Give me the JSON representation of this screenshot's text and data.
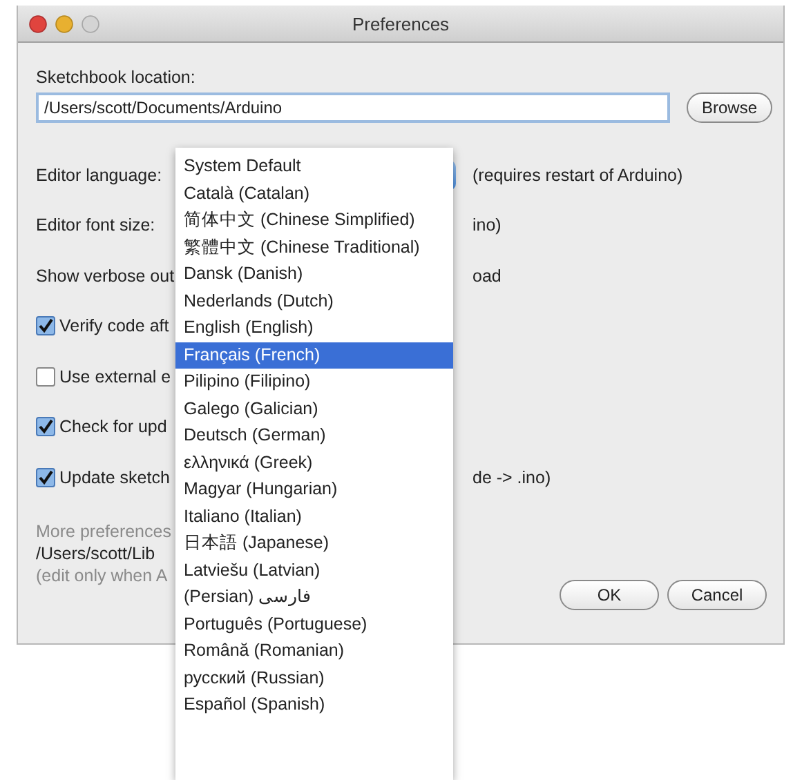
{
  "window": {
    "title": "Preferences"
  },
  "sketchbook": {
    "label": "Sketchbook location:",
    "value": "/Users/scott/Documents/Arduino",
    "button": "Browse"
  },
  "settings": [
    {
      "kind": "popup",
      "label": "Editor language:",
      "note": "(requires restart of Arduino)"
    },
    {
      "kind": "text",
      "label": "Editor font size:",
      "note": "ino)"
    },
    {
      "kind": "text",
      "label": "Show verbose out",
      "note": "oad"
    },
    {
      "kind": "checkbox",
      "label": "Verify code aft",
      "checked": true
    },
    {
      "kind": "checkbox",
      "label": "Use external e",
      "checked": false
    },
    {
      "kind": "checkbox",
      "label": "Check for upd",
      "checked": true
    },
    {
      "kind": "checkbox",
      "label": "Update sketch",
      "checked": true,
      "note": "de -> .ino)"
    }
  ],
  "more": {
    "hint": "More preferences",
    "path": "/Users/scott/Lib",
    "note": "(edit only when A"
  },
  "buttons": [
    "OK",
    "Cancel"
  ],
  "language_menu": [
    {
      "label": "System Default",
      "selected": false
    },
    {
      "label": "Català (Catalan)",
      "selected": false
    },
    {
      "label": "简体中文 (Chinese Simplified)",
      "selected": false
    },
    {
      "label": "繁體中文 (Chinese Traditional)",
      "selected": false
    },
    {
      "label": "Dansk (Danish)",
      "selected": false
    },
    {
      "label": "Nederlands (Dutch)",
      "selected": false
    },
    {
      "label": "English (English)",
      "selected": false
    },
    {
      "label": "Français (French)",
      "selected": true
    },
    {
      "label": "Pilipino (Filipino)",
      "selected": false
    },
    {
      "label": "Galego (Galician)",
      "selected": false
    },
    {
      "label": "Deutsch (German)",
      "selected": false
    },
    {
      "label": "ελληνικά (Greek)",
      "selected": false
    },
    {
      "label": "Magyar (Hungarian)",
      "selected": false
    },
    {
      "label": "Italiano (Italian)",
      "selected": false
    },
    {
      "label": "日本語 (Japanese)",
      "selected": false
    },
    {
      "label": "Latviešu (Latvian)",
      "selected": false
    },
    {
      "label": "(Persian) فارسی",
      "selected": false
    },
    {
      "label": "Português (Portuguese)",
      "selected": false
    },
    {
      "label": "Română (Romanian)",
      "selected": false
    },
    {
      "label": "русский (Russian)",
      "selected": false
    },
    {
      "label": "Español (Spanish)",
      "selected": false
    }
  ]
}
